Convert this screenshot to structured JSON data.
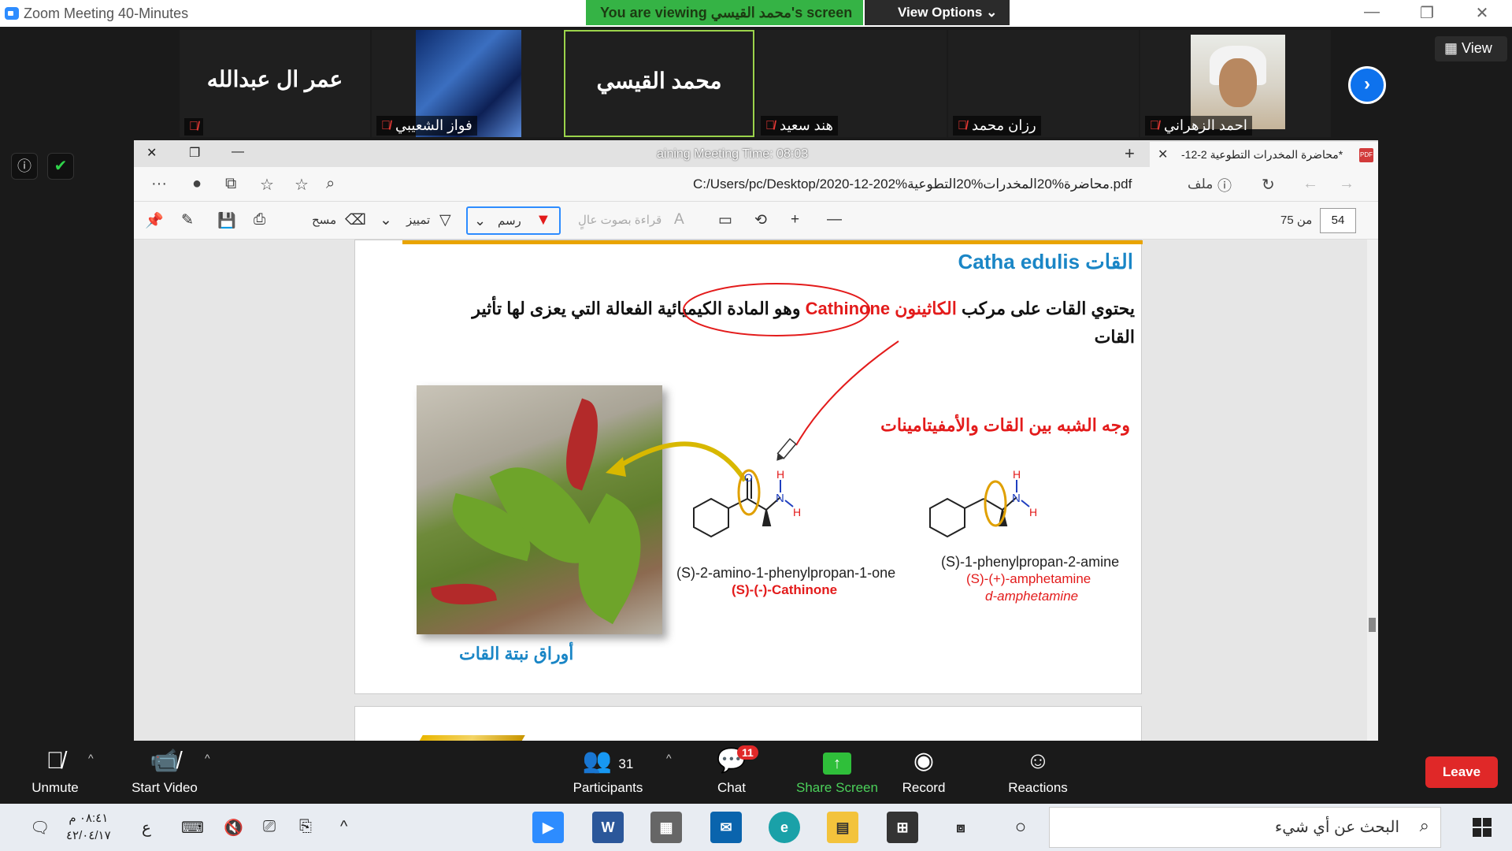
{
  "zoom": {
    "window_title": "Zoom Meeting 40-Minutes",
    "viewing_banner": "You are viewing محمد القيسي's screen",
    "view_options": "View Options ⌄",
    "view_label": "View",
    "participants": [
      {
        "name": "عمر ال عبدالله",
        "label": "",
        "type": "name"
      },
      {
        "name": "",
        "label": "فواز الشعيبي",
        "type": "image"
      },
      {
        "name": "محمد القيسي",
        "label": "",
        "type": "name-active"
      },
      {
        "name": "",
        "label": "هند سعيد",
        "type": "empty"
      },
      {
        "name": "",
        "label": "رزان محمد",
        "type": "empty"
      },
      {
        "name": "",
        "label": "احمد الزهراني",
        "type": "person"
      }
    ]
  },
  "browser": {
    "tab_title": "*محاضرة المخدرات التطوعية 2-12-",
    "meeting_time": "aining Meeting Time: 08:03",
    "url": "C:/Users/pc/Desktop/2020-12-202%محاضرة%20المخدرات%20التطوعية.pdf",
    "url_label": "ملف"
  },
  "pdf_toolbar": {
    "draw": "رسم",
    "highlight": "تمييز",
    "erase": "مسح",
    "read_aloud": "قراءة بصوت عالٍ",
    "page_current": "54",
    "page_total": "من 75"
  },
  "slide": {
    "title": "Catha edulis القات",
    "line1_pre": "يحتوي القات على مركب",
    "line1_red": "الكاثينون Cathinone",
    "line1_post": "وهو المادة الكيميائية الفعالة التي يعزى لها تأثير",
    "line2": "القات",
    "similarity": "وجه الشبه بين القات والأمفيتامينات",
    "photo_caption": "أوراق نبتة القات",
    "cathinone_name": "(S)-2-amino-1-phenylpropan-1-one",
    "cathinone_label": "(S)-(-)-Cathinone",
    "amph_name": "(S)-1-phenylpropan-2-amine",
    "amph_label1": "(S)-(+)-amphetamine",
    "amph_label2": "d-amphetamine",
    "atom_O": "O",
    "atom_N": "N",
    "atom_H": "H"
  },
  "controls": {
    "unmute": "Unmute",
    "start_video": "Start Video",
    "participants": "Participants",
    "participants_count": "31",
    "chat": "Chat",
    "chat_badge": "11",
    "share_screen": "Share Screen",
    "record": "Record",
    "reactions": "Reactions",
    "leave": "Leave"
  },
  "taskbar": {
    "time": "٠٨:٤١ م",
    "date": "٤٢/٠٤/١٧",
    "lang": "ع",
    "search_placeholder": "البحث عن أي شيء",
    "word_label": "W"
  },
  "colors": {
    "zoom_blue": "#2D8CFF",
    "banner_green": "#35b345",
    "leave_red": "#e02828",
    "slide_blue": "#1a86c6",
    "slide_red": "#e31b1b"
  }
}
